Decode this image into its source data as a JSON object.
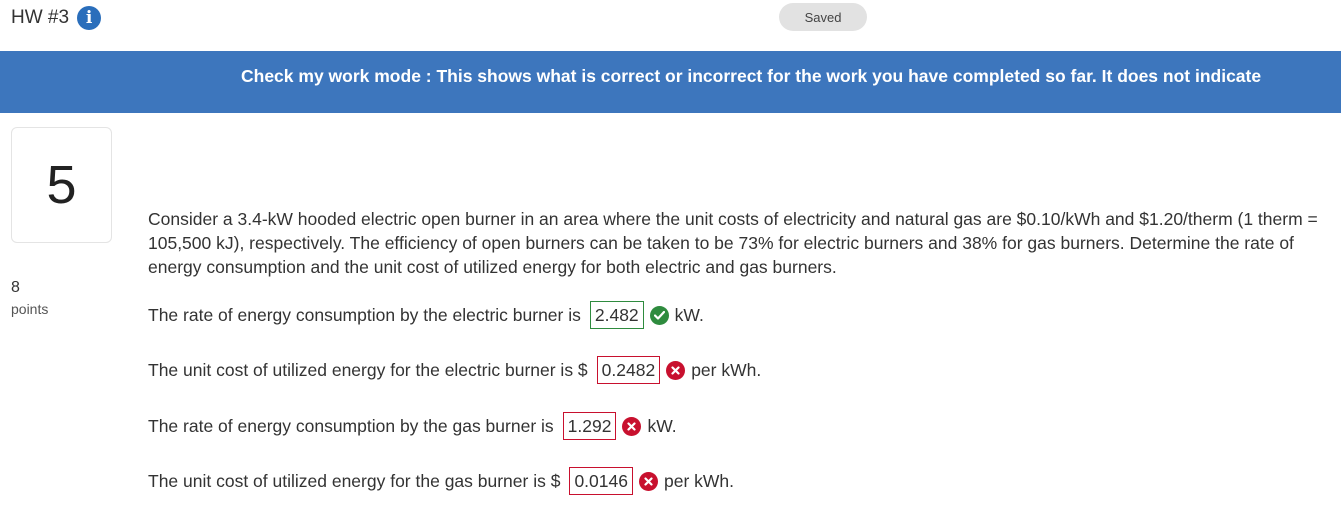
{
  "header": {
    "title": "HW #3",
    "info_icon": "info-icon",
    "status": "Saved"
  },
  "banner": {
    "text": "Check my work mode : This shows what is correct or incorrect for the work you have completed so far. It does not indicate"
  },
  "question": {
    "number": "5",
    "points": "8",
    "points_label": "points",
    "text": "Consider a 3.4-kW hooded electric open burner in an area where the unit costs of electricity and natural gas are $0.10/kWh and $1.20/therm (1 therm = 105,500 kJ), respectively. The efficiency of open burners can be taken to be 73% for electric burners and 38% for gas burners. Determine the rate of energy consumption and the unit cost of utilized energy for both electric and gas burners."
  },
  "answers": [
    {
      "prefix": "The rate of energy consumption by the electric burner is",
      "value": "2.482",
      "status": "correct",
      "suffix": "kW."
    },
    {
      "prefix": "The unit cost of utilized energy for the electric burner is $",
      "value": "0.2482",
      "status": "incorrect",
      "suffix": "per kWh."
    },
    {
      "prefix": "The rate of energy consumption by the gas burner is",
      "value": "1.292",
      "status": "incorrect",
      "suffix": "kW."
    },
    {
      "prefix": "The unit cost of utilized energy for the gas burner is $",
      "value": "0.0146",
      "status": "incorrect",
      "suffix": "per kWh."
    }
  ],
  "colors": {
    "banner": "#3d76bd",
    "correct": "#2e8b3e",
    "incorrect": "#c8102e",
    "info": "#2a6ebb"
  }
}
